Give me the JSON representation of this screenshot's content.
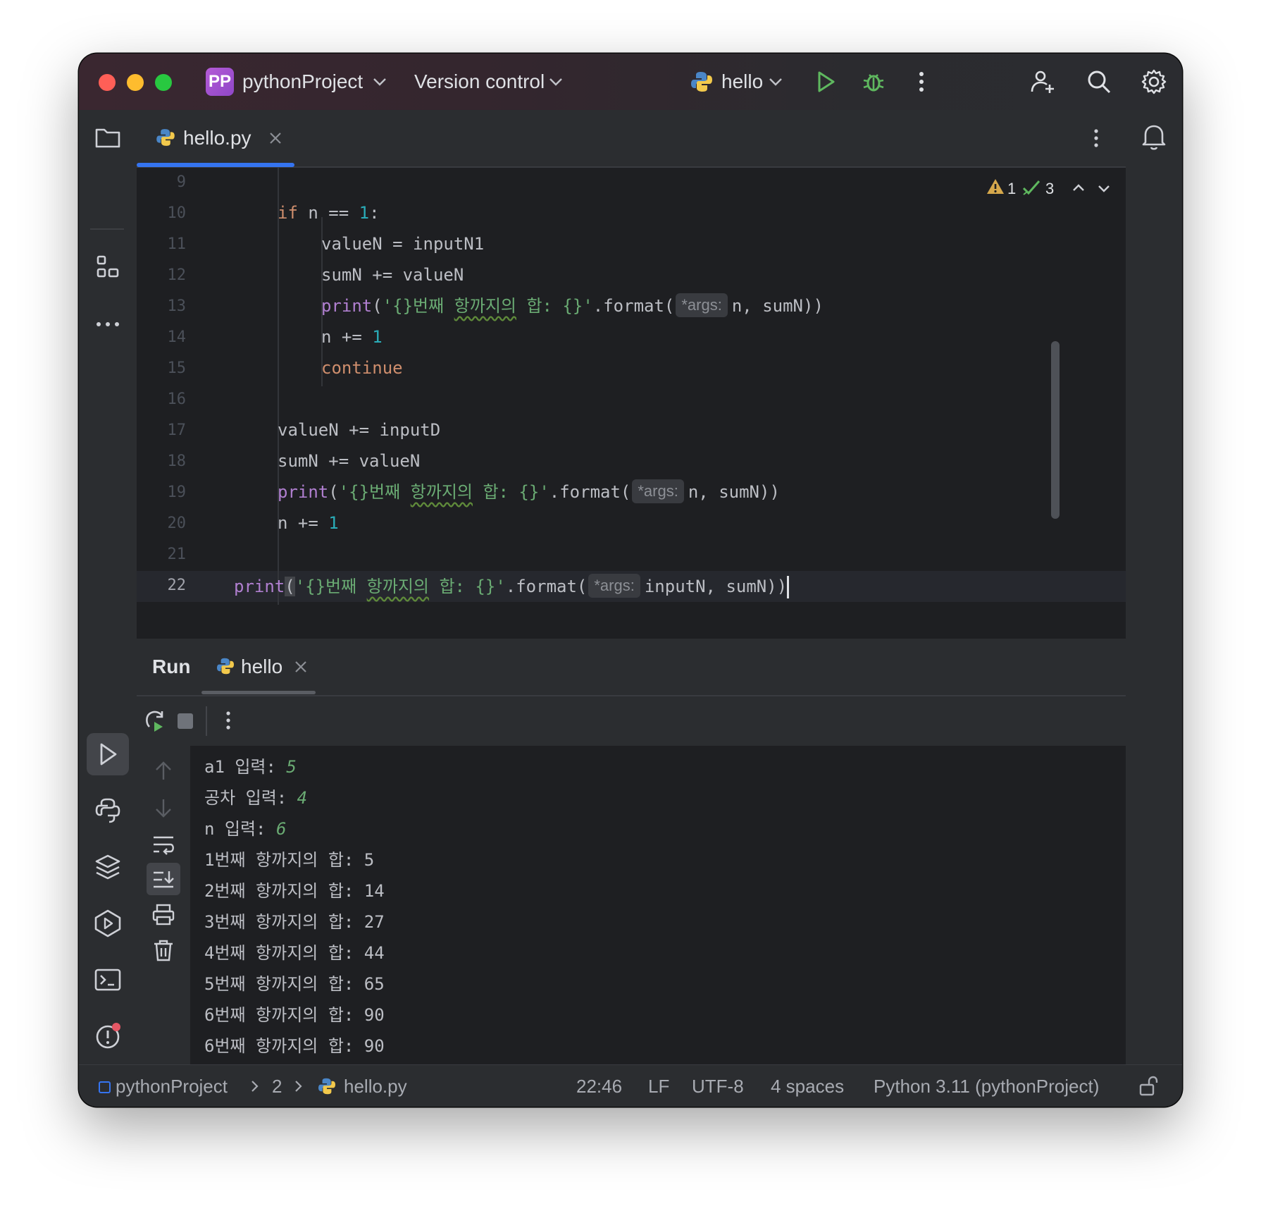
{
  "titlebar": {
    "project_badge": "PP",
    "project_name": "pythonProject",
    "vcs_label": "Version control",
    "run_config": "hello"
  },
  "editor": {
    "tab_label": "hello.py",
    "inspections": {
      "warnings": "1",
      "ok": "3"
    },
    "line_numbers": [
      "9",
      "10",
      "11",
      "12",
      "13",
      "14",
      "15",
      "16",
      "17",
      "18",
      "19",
      "20",
      "21",
      "22"
    ],
    "code": {
      "l10_kw": "if",
      "l10_rest": " n == ",
      "l10_num": "1",
      "l10_end": ":",
      "l11": "valueN = inputN1",
      "l12": "sumN += valueN",
      "print_fn": "print",
      "str_open": "'{}번째 ",
      "str_mid": "항까지의",
      "str_close": " 합: {}'",
      "format_call": ".format(",
      "hint": "*args:",
      "l13_args": "n, sumN))",
      "l14_rest": "n += ",
      "l14_num": "1",
      "l15": "continue",
      "l17": "valueN += inputD",
      "l18": "sumN += valueN",
      "l19_args": "n, sumN))",
      "l20_rest": "n += ",
      "l20_num": "1",
      "l22_args": "inputN, sumN))"
    }
  },
  "run": {
    "title": "Run",
    "tab_label": "hello",
    "output": [
      {
        "prompt": "a1 입력: ",
        "input": "5"
      },
      {
        "prompt": "공차 입력: ",
        "input": "4"
      },
      {
        "prompt": "n 입력: ",
        "input": "6"
      },
      {
        "text": "1번째 항까지의 합: 5"
      },
      {
        "text": "2번째 항까지의 합: 14"
      },
      {
        "text": "3번째 항까지의 합: 27"
      },
      {
        "text": "4번째 항까지의 합: 44"
      },
      {
        "text": "5번째 항까지의 합: 65"
      },
      {
        "text": "6번째 항까지의 합: 90"
      },
      {
        "text": "6번째 항까지의 합: 90"
      }
    ]
  },
  "statusbar": {
    "breadcrumb_project": "pythonProject",
    "breadcrumb_folder": "2",
    "breadcrumb_file": "hello.py",
    "position": "22:46",
    "line_ending": "LF",
    "encoding": "UTF-8",
    "indent": "4 spaces",
    "interpreter": "Python 3.11 (pythonProject)"
  },
  "colors": {
    "accent": "#3574f0",
    "keyword": "#cf8e6d",
    "function": "#b07fd0",
    "number": "#2aacb8",
    "string": "#6aab73",
    "run_green": "#5fb85f"
  }
}
